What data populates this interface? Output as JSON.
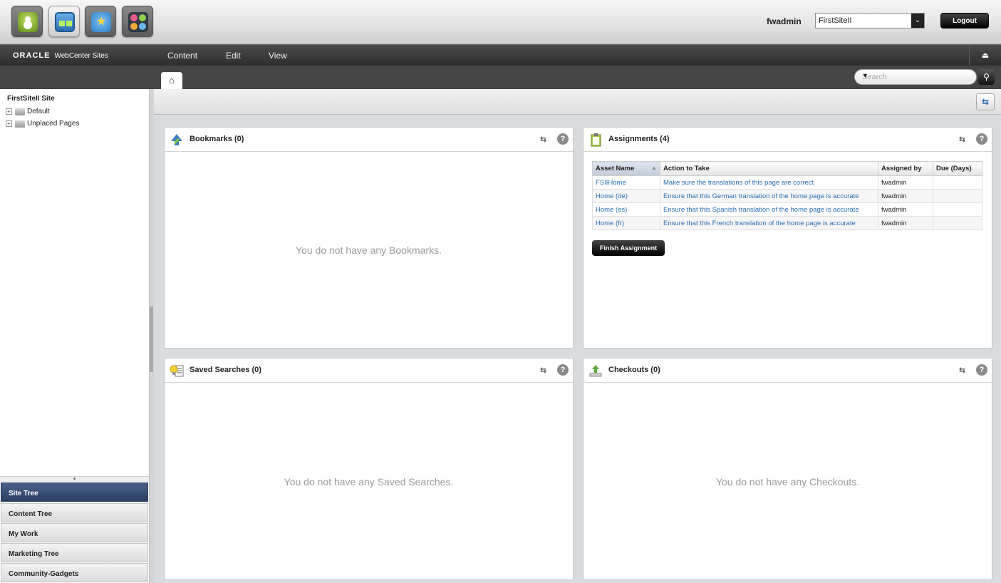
{
  "header": {
    "username": "fwadmin",
    "site_select": "FirstSiteII",
    "logout_label": "Logout"
  },
  "menubar": {
    "brand_oracle": "ORACLE",
    "brand_product": "WebCenter Sites",
    "items": [
      "Content",
      "Edit",
      "View"
    ]
  },
  "tabbar": {
    "search_placeholder": "Search"
  },
  "tree": {
    "title": "FirstSiteII Site",
    "nodes": [
      "Default",
      "Unplaced Pages"
    ]
  },
  "accordion": [
    "Site Tree",
    "Content Tree",
    "My Work",
    "Marketing Tree",
    "Community-Gadgets"
  ],
  "panels": {
    "bookmarks": {
      "title": "Bookmarks (0)",
      "empty": "You do not have any Bookmarks."
    },
    "assignments": {
      "title": "Assignments (4)",
      "columns": [
        "Asset Name",
        "Action to Take",
        "Assigned by",
        "Due (Days)"
      ],
      "rows": [
        [
          "FSIIHome",
          "Make sure the translations of this page are correct",
          "fwadmin",
          ""
        ],
        [
          "Home (de)",
          "Ensure that this German translation of the home page is accurate",
          "fwadmin",
          ""
        ],
        [
          "Home (es)",
          "Ensure that this Spanish translation of the home page is accurate",
          "fwadmin",
          ""
        ],
        [
          "Home (fr)",
          "Ensure that this French translation of the home page is accurate",
          "fwadmin",
          ""
        ]
      ],
      "finish_label": "Finish Assignment"
    },
    "saved_searches": {
      "title": "Saved Searches (0)",
      "empty": "You do not have any Saved Searches."
    },
    "checkouts": {
      "title": "Checkouts (0)",
      "empty": "You do not have any Checkouts."
    }
  },
  "colors": {
    "link": "#2a6fb7",
    "accordion_active": "#2b3f63"
  }
}
